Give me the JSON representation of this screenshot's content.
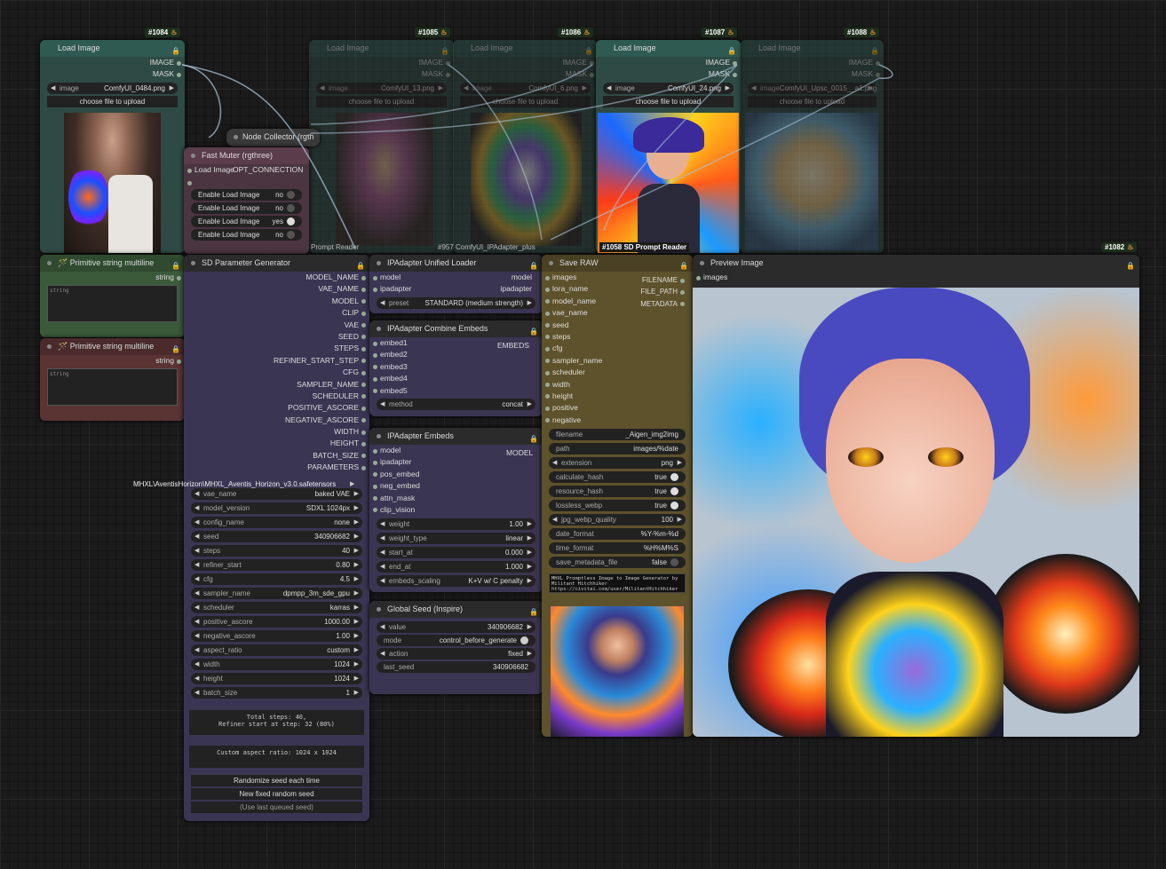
{
  "badges": {
    "n1084": "#1084",
    "n1085": "#1085",
    "n1086": "#1086",
    "n1087": "#1087",
    "n1088": "#1088",
    "n1082": "#1082"
  },
  "load_images": [
    {
      "title": "Load Image",
      "image_label": "image",
      "file": "ComfyUI_0484.png",
      "upload": "choose file to upload",
      "out1": "IMAGE",
      "out2": "MASK"
    },
    {
      "title": "Load Image",
      "image_label": "image",
      "file": "ComfyUI_13.png",
      "upload": "choose file to upload",
      "out1": "IMAGE",
      "out2": "MASK"
    },
    {
      "title": "Load Image",
      "image_label": "image",
      "file": "ComfyUI_6.png",
      "upload": "choose file to upload",
      "out1": "IMAGE",
      "out2": "MASK"
    },
    {
      "title": "Load Image",
      "image_label": "image",
      "file": "ComfyUI_24.png",
      "upload": "choose file to upload",
      "out1": "IMAGE",
      "out2": "MASK"
    },
    {
      "title": "Load Image",
      "image_label": "image",
      "file": "ComfyUI_Upsc_0015__a1.png",
      "upload": "choose file to upload",
      "out1": "IMAGE",
      "out2": "MASK"
    }
  ],
  "overlay_labels": {
    "prompt_reader_a": "Prompt Reader",
    "ipadapter_plus": "#957 ComfyUI_IPAdapter_plus",
    "sd_prompt_reader": "#1058 SD Prompt Reader"
  },
  "node_collector": {
    "title": "Node Collector (rgth"
  },
  "fast_muter": {
    "title": "Fast Muter (rgthree)",
    "input": "Load Image",
    "output": "OPT_CONNECTION",
    "toggles": [
      {
        "label": "Enable Load Image",
        "value": "no"
      },
      {
        "label": "Enable Load Image",
        "value": "no"
      },
      {
        "label": "Enable Load Image",
        "value": "yes"
      },
      {
        "label": "Enable Load Image",
        "value": "no"
      }
    ]
  },
  "prim1": {
    "title": "Primitive string multiline",
    "output": "string",
    "placeholder": "string"
  },
  "prim2": {
    "title": "Primitive string multiline",
    "output": "string",
    "placeholder": "string"
  },
  "sdparam": {
    "title": "SD Parameter Generator",
    "outputs": [
      "MODEL_NAME",
      "VAE_NAME",
      "MODEL",
      "CLIP",
      "VAE",
      "SEED",
      "STEPS",
      "REFINER_START_STEP",
      "CFG",
      "SAMPLER_NAME",
      "SCHEDULER",
      "POSITIVE_ASCORE",
      "NEGATIVE_ASCORE",
      "WIDTH",
      "HEIGHT",
      "BATCH_SIZE",
      "PARAMETERS"
    ],
    "ckpt_overflow": "MHXL\\AventisHorizon\\MHXL_Aventis_Horizon_v3.0.safetensors",
    "widgets": [
      {
        "label": "vae_name",
        "value": "baked VAE"
      },
      {
        "label": "model_version",
        "value": "SDXL 1024px"
      },
      {
        "label": "config_name",
        "value": "none"
      },
      {
        "label": "seed",
        "value": "340906682"
      },
      {
        "label": "steps",
        "value": "40"
      },
      {
        "label": "refiner_start",
        "value": "0.80"
      },
      {
        "label": "cfg",
        "value": "4.5"
      },
      {
        "label": "sampler_name",
        "value": "dpmpp_3m_sde_gpu"
      },
      {
        "label": "scheduler",
        "value": "karras"
      },
      {
        "label": "positive_ascore",
        "value": "1000.00"
      },
      {
        "label": "negative_ascore",
        "value": "1.00"
      },
      {
        "label": "aspect_ratio",
        "value": "custom"
      },
      {
        "label": "width",
        "value": "1024"
      },
      {
        "label": "height",
        "value": "1024"
      },
      {
        "label": "batch_size",
        "value": "1"
      }
    ],
    "info1": "Total steps: 40,\nRefiner start at step: 32 (80%)",
    "info2": "Custom aspect ratio: 1024 x 1024",
    "btn1": "Randomize seed each time",
    "btn2": "New fixed random seed",
    "btn3": "(Use last queued seed)"
  },
  "ipa_loader": {
    "title": "IPAdapter Unified Loader",
    "in1": "model",
    "in2": "ipadapter",
    "out1": "model",
    "out2": "ipadapter",
    "preset_label": "preset",
    "preset_value": "STANDARD (medium strength)"
  },
  "ipa_combine": {
    "title": "IPAdapter Combine Embeds",
    "inputs": [
      "embed1",
      "embed2",
      "embed3",
      "embed4",
      "embed5"
    ],
    "output": "EMBEDS",
    "method_label": "method",
    "method_value": "concat"
  },
  "ipa_embeds": {
    "title": "IPAdapter Embeds",
    "inputs": [
      "model",
      "ipadapter",
      "pos_embed",
      "neg_embed",
      "attn_mask",
      "clip_vision"
    ],
    "output": "MODEL",
    "widgets": [
      {
        "label": "weight",
        "value": "1.00"
      },
      {
        "label": "weight_type",
        "value": "linear"
      },
      {
        "label": "start_at",
        "value": "0.000"
      },
      {
        "label": "end_at",
        "value": "1.000"
      },
      {
        "label": "embeds_scaling",
        "value": "K+V w/ C penalty"
      }
    ]
  },
  "global_seed": {
    "title": "Global Seed (Inspire)",
    "widgets": [
      {
        "label": "value",
        "value": "340906682"
      },
      {
        "label": "mode",
        "value": "control_before_generate"
      },
      {
        "label": "action",
        "value": "fixed"
      },
      {
        "label": "last_seed",
        "value": "340906682"
      }
    ]
  },
  "save_raw": {
    "title": "Save RAW",
    "inputs": [
      "images",
      "lora_name",
      "model_name",
      "vae_name",
      "seed",
      "steps",
      "cfg",
      "sampler_name",
      "scheduler",
      "width",
      "height",
      "positive",
      "negative"
    ],
    "outputs": [
      "FILENAME",
      "FILE_PATH",
      "METADATA"
    ],
    "widgets": [
      {
        "label": "filename",
        "value": "_Aigen_img2img"
      },
      {
        "label": "path",
        "value": "images/%date"
      },
      {
        "label": "extension",
        "value": "png"
      },
      {
        "label": "calculate_hash",
        "value": "true"
      },
      {
        "label": "resource_hash",
        "value": "true"
      },
      {
        "label": "lossless_webp",
        "value": "true"
      },
      {
        "label": "jpg_webp_quality",
        "value": "100"
      },
      {
        "label": "date_format",
        "value": "%Y-%m-%d"
      },
      {
        "label": "time_format",
        "value": "%H%M%S"
      },
      {
        "label": "save_metadata_file",
        "value": "false"
      }
    ],
    "note": "MHXL Promptless Image to Image Generator by Militant Hitchhiker\nhttps://civitai.com/user/MilitantHitchhiker"
  },
  "preview": {
    "title": "Preview Image",
    "input": "images"
  },
  "colors": {
    "green": "#335533",
    "teal": "#2f4f4a",
    "purple": "#3a3552",
    "olive": "#5e522c",
    "red": "#5a3333",
    "plum": "#4a3540",
    "dark": "#2b2b2b"
  }
}
